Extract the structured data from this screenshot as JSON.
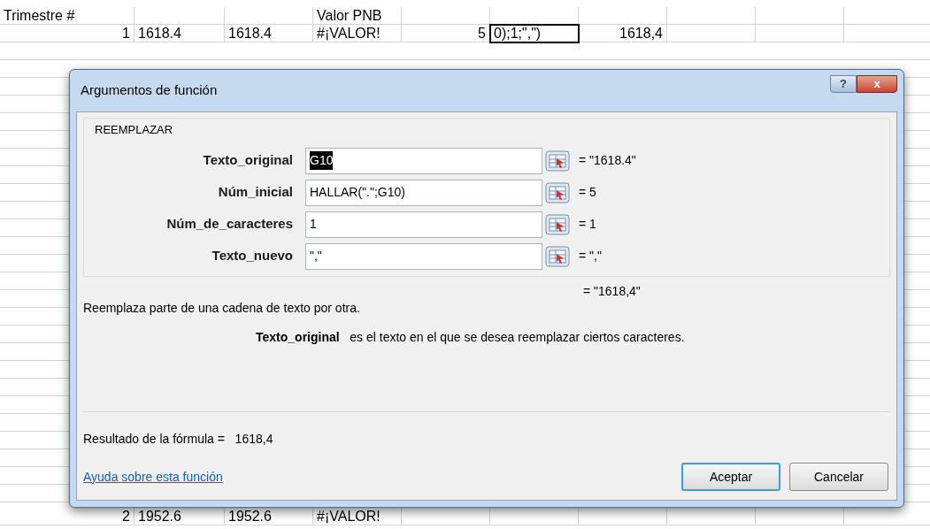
{
  "sheet": {
    "rows": [
      {
        "column_1": {
          "text": "Trimestre #",
          "selected": false
        },
        "column_4": {
          "text": "Valor PNB",
          "selected": false
        }
      },
      {
        "column_1": {
          "text": "1",
          "selected": false
        },
        "column_2": {
          "text": "1618.4",
          "selected": false
        },
        "column_3": {
          "text": "1618.4",
          "selected": false
        },
        "column_4": {
          "text": "#¡VALOR!",
          "selected": false
        },
        "column_5": {
          "text": "5",
          "selected": false
        },
        "column_6": {
          "text": "0);1;\",\")",
          "selected": true
        },
        "column_7": {
          "text": "1618,4",
          "selected": false
        }
      },
      {
        "column_1": {
          "text": "2",
          "selected": false
        },
        "column_2": {
          "text": "1952.6",
          "selected": false
        },
        "column_3": {
          "text": "1952.6",
          "selected": false
        },
        "column_4": {
          "text": "#¡VALOR!",
          "selected": false
        }
      }
    ]
  },
  "dialog": {
    "title": "Argumentos de función",
    "help_button": "?",
    "close_button": "x",
    "function_name": "REEMPLAZAR",
    "arguments": [
      {
        "label": "Texto_original",
        "value": "G10",
        "selected": true,
        "result": "= \"1618.4\""
      },
      {
        "label": "Núm_inicial",
        "value": "HALLAR(\".\";G10)",
        "selected": false,
        "result": "= 5"
      },
      {
        "label": "Núm_de_caracteres",
        "value": "1",
        "selected": false,
        "result": "= 1"
      },
      {
        "label": "Texto_nuevo",
        "value": "\",\"",
        "selected": false,
        "result": "= \",\""
      }
    ],
    "overall_result": "= \"1618,4\"",
    "description": "Reemplaza parte de una cadena de texto por otra.",
    "argument_help": "**Texto_original**   es el texto en el que se desea reemplazar ciertos caracteres.",
    "formula_result": "Resultado de la fórmula =   1618,4",
    "help_link": "Ayuda sobre esta función",
    "buttons": [
      {
        "label": "Aceptar",
        "default": true
      },
      {
        "label": "Cancelar",
        "default": false
      }
    ]
  }
}
